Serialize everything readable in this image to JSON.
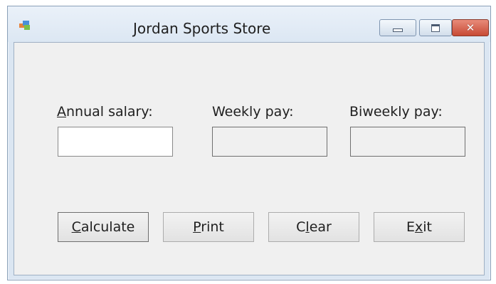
{
  "window": {
    "title": "Jordan Sports Store",
    "controls": {
      "minimize": "minimize-icon",
      "maximize": "maximize-icon",
      "close": "close-icon"
    },
    "accent_color": "#d9e4f1",
    "close_color": "#c74a35"
  },
  "form": {
    "annual_salary": {
      "label": "Annual salary:",
      "mnemonic": "A",
      "value": ""
    },
    "weekly_pay": {
      "label": "Weekly pay:",
      "value": ""
    },
    "biweekly_pay": {
      "label": "Biweekly pay:",
      "value": ""
    }
  },
  "buttons": {
    "calculate": {
      "label": "Calculate",
      "mnemonic": "C"
    },
    "print": {
      "label": "Print",
      "mnemonic": "P"
    },
    "clear": {
      "label": "Clear",
      "mnemonic": "l"
    },
    "exit": {
      "label": "Exit",
      "mnemonic": "x"
    }
  }
}
